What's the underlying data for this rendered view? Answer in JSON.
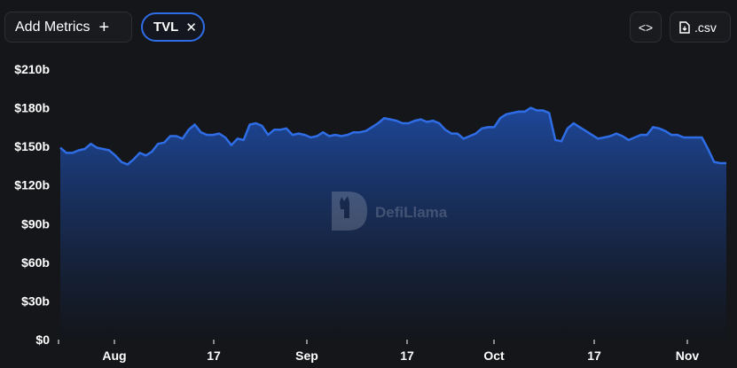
{
  "toolbar": {
    "add_metrics_label": "Add Metrics",
    "add_icon": "plus-icon",
    "metric_pill_label": "TVL",
    "remove_icon": "close-icon",
    "embed_icon": "code-icon",
    "csv_label": ".csv",
    "csv_icon": "file-download-icon"
  },
  "watermark": {
    "text": "DefiLlama",
    "icon": "llama-logo"
  },
  "colors": {
    "line": "#2e6de6",
    "fill_top": "#1e4aa0",
    "fill_bottom": "#12151c",
    "background": "#151619"
  },
  "chart_data": {
    "type": "area",
    "title": "",
    "xlabel": "",
    "ylabel": "",
    "grid": false,
    "ylim": [
      0,
      210
    ],
    "y_unit": "b",
    "y_ticks": [
      "$0",
      "$30b",
      "$60b",
      "$90b",
      "$120b",
      "$150b",
      "$180b",
      "$210b"
    ],
    "x_ticks": [
      "Aug",
      "17",
      "Sep",
      "17",
      "Oct",
      "17",
      "Nov"
    ],
    "series": [
      {
        "values": [
          149,
          145,
          145,
          147,
          148,
          152,
          149,
          148,
          147,
          143,
          138,
          136,
          140,
          145,
          143,
          146,
          152,
          153,
          158,
          158,
          156,
          163,
          167,
          161,
          159,
          159,
          160,
          157,
          151,
          156,
          155,
          167,
          168,
          166,
          159,
          163,
          163,
          164,
          159,
          160,
          159,
          157,
          158,
          161,
          158,
          159,
          158,
          159,
          161,
          161,
          162,
          165,
          168,
          172,
          171,
          170,
          168,
          168,
          170,
          171,
          169,
          170,
          168,
          163,
          160,
          160,
          156,
          158,
          160,
          164,
          165,
          165,
          172,
          175,
          176,
          177,
          177,
          180,
          178,
          178,
          176,
          155,
          154,
          164,
          168,
          165,
          162,
          159,
          156,
          157,
          158,
          160,
          158,
          155,
          157,
          159,
          159,
          165,
          164,
          162,
          159,
          159,
          157,
          157,
          157,
          157,
          148,
          138,
          137,
          137
        ]
      }
    ]
  }
}
